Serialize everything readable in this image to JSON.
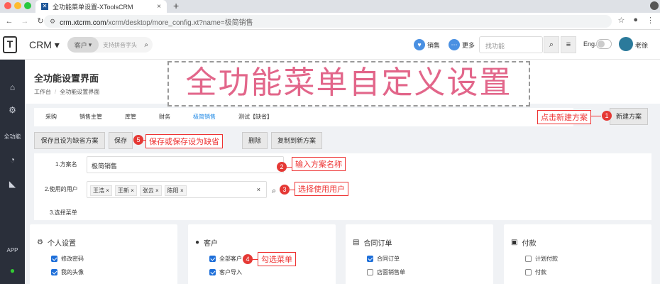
{
  "browser": {
    "tab_title": "全功能菜单设置-XToolsCRM",
    "tab_close": "×",
    "new_tab": "+",
    "url_host": "crm.xtcrm.com",
    "url_path": "/xcrm/desktop/more_config.xt?name=极简销售"
  },
  "header": {
    "brand": "CRM",
    "customer_select": "客户",
    "search_placeholder": "支持拼音字头",
    "sales_label": "销售",
    "more_label": "更多",
    "func_placeholder": "找功能",
    "lang_label": "Eng.",
    "user_name": "老徐"
  },
  "sidebar": {
    "items": [
      {
        "label": "",
        "icon": "sitemap-icon"
      },
      {
        "label": "",
        "icon": "cogs-icon"
      },
      {
        "label": "全功能",
        "icon": ""
      },
      {
        "label": "",
        "icon": "dashboard-icon"
      },
      {
        "label": "",
        "icon": "area-chart-icon"
      },
      {
        "label": "APP",
        "icon": ""
      },
      {
        "label": "",
        "icon": "wechat-icon"
      }
    ]
  },
  "page": {
    "title": "全功能设置界面",
    "breadcrumb": [
      "工作台",
      "全功能设置界面"
    ],
    "overlay_title": "全功能菜单自定义设置"
  },
  "tabs": [
    {
      "label": "采购",
      "active": false
    },
    {
      "label": "销售主管",
      "active": false
    },
    {
      "label": "库管",
      "active": false
    },
    {
      "label": "财务",
      "active": false
    },
    {
      "label": "极简销售",
      "active": true
    },
    {
      "label": "测试【缺省】",
      "active": false
    }
  ],
  "buttons": {
    "new_plan": "新建方案",
    "save_default": "保存且设为缺省方案",
    "save": "保存",
    "delete": "删除",
    "copy_new": "复制到新方案"
  },
  "form": {
    "plan_name_label": "1.方案名",
    "plan_name_value": "极简销售",
    "users_label": "2.使用的用户",
    "users": [
      "王浩",
      "王新",
      "张云",
      "陈阳"
    ],
    "tag_remove": "×",
    "clear": "×",
    "menu_label": "3.选择菜单"
  },
  "cards": [
    {
      "title": "个人设置",
      "icon": "cogs-icon",
      "items": [
        {
          "label": "修改密码",
          "checked": true
        },
        {
          "label": "我的头像",
          "checked": true
        }
      ]
    },
    {
      "title": "客户",
      "icon": "user-icon",
      "items": [
        {
          "label": "全部客户",
          "checked": true
        },
        {
          "label": "客户导入",
          "checked": true
        }
      ]
    },
    {
      "title": "合同订单",
      "icon": "file-icon",
      "items": [
        {
          "label": "合同订单",
          "checked": true
        },
        {
          "label": "店面销售单",
          "checked": false
        }
      ]
    },
    {
      "title": "付款",
      "icon": "money-icon",
      "items": [
        {
          "label": "计划付款",
          "checked": false
        },
        {
          "label": "付款",
          "checked": false
        }
      ]
    }
  ],
  "annotations": {
    "a1": {
      "num": "1",
      "text": "点击新建方案"
    },
    "a2": {
      "num": "2",
      "text": "输入方案名称"
    },
    "a3": {
      "num": "3",
      "text": "选择使用用户"
    },
    "a4": {
      "num": "4",
      "text": "勾选菜单"
    },
    "a5": {
      "num": "5",
      "text": "保存或保存设为缺省"
    }
  },
  "colors": {
    "accent": "#1e88e5",
    "annotation": "#e53935",
    "overlay_text": "#e2668a",
    "sidebar_bg": "#2a2f3a"
  }
}
